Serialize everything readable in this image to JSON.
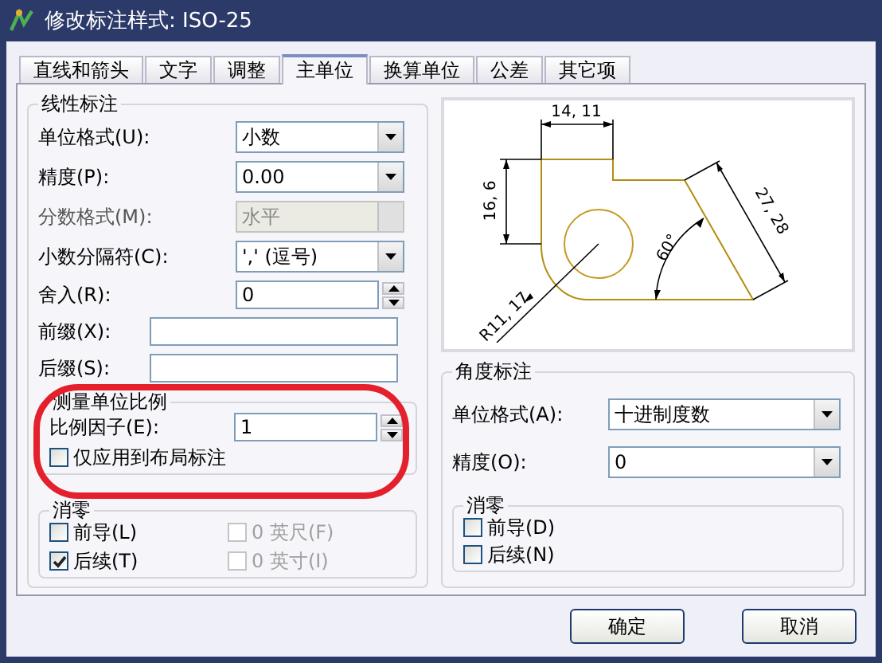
{
  "window": {
    "title": "修改标注样式: ISO-25"
  },
  "tabs": [
    {
      "label": "直线和箭头",
      "selected": false
    },
    {
      "label": "文字",
      "selected": false
    },
    {
      "label": "调整",
      "selected": false
    },
    {
      "label": "主单位",
      "selected": true
    },
    {
      "label": "换算单位",
      "selected": false
    },
    {
      "label": "公差",
      "selected": false
    },
    {
      "label": "其它项",
      "selected": false
    }
  ],
  "linear": {
    "title": "线性标注",
    "fields": [
      {
        "kind": "dropdown",
        "label": "单位格式(U):",
        "value": "小数",
        "disabled": false
      },
      {
        "kind": "dropdown",
        "label": "精度(P):",
        "value": "0.00",
        "disabled": false
      },
      {
        "kind": "dropdown",
        "label": "分数格式(M):",
        "value": "水平",
        "disabled": true
      },
      {
        "kind": "dropdown",
        "label": "小数分隔符(C):",
        "value": "','  (逗号)",
        "disabled": false
      },
      {
        "kind": "spinner",
        "label": "舍入(R):",
        "value": "0",
        "disabled": false
      },
      {
        "kind": "text",
        "label": "前缀(X):",
        "disabled": false
      },
      {
        "kind": "text",
        "label": "后缀(S):",
        "disabled": false
      }
    ],
    "scale": {
      "title": "测量单位比例",
      "factor": {
        "label": "比例因子(E):",
        "value": "1"
      },
      "layout_only": {
        "label": "仅应用到布局标注",
        "checked": false
      }
    },
    "zero": {
      "title": "消零",
      "options": [
        {
          "label": "前导(L)",
          "checked": false,
          "disabled": false
        },
        {
          "label": "0 英尺(F)",
          "checked": false,
          "disabled": true
        },
        {
          "label": "后续(T)",
          "checked": true,
          "disabled": false
        },
        {
          "label": "0 英寸(I)",
          "checked": false,
          "disabled": true
        }
      ]
    }
  },
  "preview": {
    "labels": [
      "14, 11",
      "16, 6",
      "27, 28",
      "60°",
      "R11, 17"
    ]
  },
  "angular": {
    "title": "角度标注",
    "fields": [
      {
        "kind": "dropdown",
        "label": "单位格式(A):",
        "value": "十进制度数",
        "disabled": false
      },
      {
        "kind": "dropdown",
        "label": "精度(O):",
        "value": "0",
        "disabled": false
      }
    ],
    "zero": {
      "title": "消零",
      "options": [
        {
          "label": "前导(D)",
          "checked": false,
          "disabled": false
        },
        {
          "label": "后续(N)",
          "checked": false,
          "disabled": false
        }
      ]
    }
  },
  "buttons": [
    "确定",
    "取消"
  ]
}
